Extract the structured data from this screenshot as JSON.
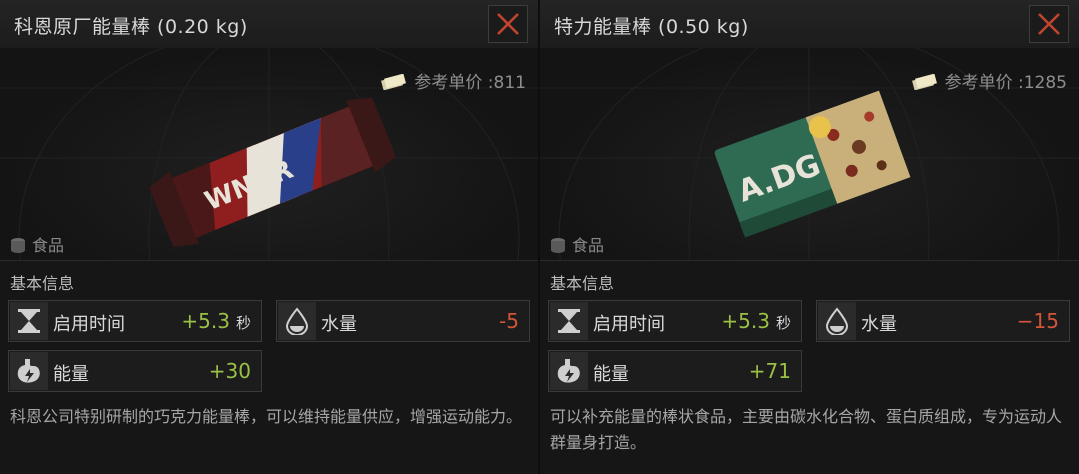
{
  "left": {
    "title": "科恩原厂能量棒 (0.20 kg)",
    "price_label": "参考单价 :811",
    "category": "食品",
    "basic_info_label": "基本信息",
    "stats": {
      "use_time": {
        "label": "启用时间",
        "value": "+5.3",
        "unit": "秒"
      },
      "water": {
        "label": "水量",
        "value": "-5"
      },
      "energy": {
        "label": "能量",
        "value": "+30"
      }
    },
    "description": "科恩公司特别研制的巧克力能量棒，可以维持能量供应，增强运动能力。",
    "image_text": "WNNR"
  },
  "right": {
    "title": "特力能量棒 (0.50 kg)",
    "price_label": "参考单价 :1285",
    "category": "食品",
    "basic_info_label": "基本信息",
    "stats": {
      "use_time": {
        "label": "启用时间",
        "value": "+5.3",
        "unit": "秒"
      },
      "water": {
        "label": "水量",
        "value": "−15"
      },
      "energy": {
        "label": "能量",
        "value": "+71"
      }
    },
    "description": "可以补充能量的棒状食品，主要由碳水化合物、蛋白质组成，专为运动人群量身打造。",
    "image_text": "A.DG"
  },
  "colors": {
    "positive": "#9ac045",
    "negative": "#d2553a",
    "close_icon": "#c0452c"
  },
  "icons": {
    "close": "close-icon",
    "money": "money-icon",
    "category": "food-can-icon",
    "use_time": "hourglass-icon",
    "water": "water-drop-icon",
    "energy": "stomach-energy-icon"
  }
}
